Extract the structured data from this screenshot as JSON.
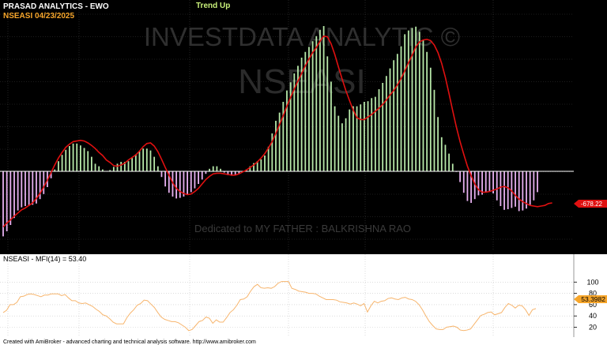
{
  "header": {
    "title": "PRASAD ANALYTICS - EWO",
    "symbol_date": "NSEASI  04/23/2025",
    "trend": "Trend Up"
  },
  "watermarks": {
    "brand": "INVESTDATA ANALYTIC ©",
    "symbol": "NSEASI",
    "dedication": "Dedicated to MY FATHER : BALKRISHNA RAO"
  },
  "footer": "Created with AmiBroker - advanced charting and technical analysis software. http://www.amibroker.com",
  "colors": {
    "top_bg": "#000000",
    "bar_up": "#b7e8a9",
    "bar_down": "#e7b0f0",
    "signal_line": "#e01010",
    "title_white": "#ffffff",
    "title_orange": "#f7a62b",
    "trend_green": "#c9f07a",
    "mfi_line": "#f7b56d",
    "value_label_bg": "#e01010",
    "mfi_label_bg": "#f7a62b"
  },
  "chart_data": [
    {
      "type": "bar",
      "series": [
        {
          "name": "EWO",
          "values": [
            -103,
            -95,
            -85,
            -74,
            -62,
            -57,
            -55,
            -55,
            -53,
            -51,
            -44,
            -36,
            -25,
            -11,
            3,
            16,
            26,
            34,
            40,
            44,
            44,
            41,
            37,
            32,
            23,
            12,
            8,
            3,
            0,
            2,
            7,
            12,
            15,
            15,
            16,
            21,
            27,
            32,
            36,
            36,
            33,
            23,
            8,
            -9,
            -24,
            -34,
            -40,
            -43,
            -42,
            -40,
            -37,
            -33,
            -27,
            -20,
            -13,
            -4,
            4,
            8,
            8,
            4,
            -2,
            -6,
            -7,
            -6,
            -4,
            -1,
            3,
            8,
            13,
            16,
            19,
            25,
            39,
            60,
            80,
            93,
            110,
            128,
            141,
            155,
            167,
            180,
            189,
            197,
            206,
            214,
            224,
            230,
            182,
            142,
            103,
            88,
            76,
            84,
            98,
            103,
            103,
            106,
            110,
            111,
            116,
            118,
            130,
            140,
            151,
            163,
            176,
            186,
            198,
            217,
            223,
            227,
            229,
            221,
            208,
            189,
            164,
            129,
            86,
            54,
            42,
            28,
            12,
            -1,
            -17,
            -34,
            -47,
            -50,
            -44,
            -38,
            -37,
            -33,
            -32,
            -35,
            -46,
            -55,
            -61,
            -60,
            -58,
            -56,
            -63,
            -62,
            -59,
            -53,
            -46,
            -33
          ]
        },
        {
          "name": "Signal",
          "values": [
            -88,
            -82,
            -77,
            -71,
            -66,
            -61,
            -58,
            -54,
            -50,
            -43,
            -35,
            -25,
            -14,
            -2,
            10,
            21,
            30,
            38,
            43,
            47,
            48,
            49,
            48,
            45,
            41,
            36,
            30,
            25,
            18,
            14,
            9,
            8,
            10,
            13,
            18,
            22,
            26,
            32,
            39,
            44,
            45,
            40,
            31,
            19,
            6,
            -6,
            -18,
            -27,
            -32,
            -35,
            -37,
            -36,
            -32,
            -27,
            -20,
            -13,
            -8,
            -4,
            -3,
            -3,
            -4,
            -5,
            -6,
            -6,
            -4,
            -1,
            2,
            6,
            10,
            15,
            21,
            28,
            37,
            47,
            60,
            74,
            88,
            103,
            117,
            130,
            143,
            155,
            167,
            178,
            188,
            196,
            206,
            214,
            213,
            202,
            185,
            165,
            146,
            128,
            112,
            97,
            85,
            82,
            82,
            86,
            90,
            95,
            100,
            106,
            113,
            121,
            128,
            137,
            147,
            159,
            172,
            184,
            197,
            205,
            208,
            209,
            207,
            200,
            188,
            171,
            149,
            123,
            96,
            70,
            47,
            27,
            8,
            -7,
            -20,
            -29,
            -33,
            -33,
            -32,
            -30,
            -28,
            -25,
            -24,
            -26,
            -31,
            -38,
            -44,
            -48,
            -51,
            -54,
            -55,
            -56,
            -55,
            -54,
            -51,
            -50
          ]
        }
      ],
      "current_value_label": "-678.22",
      "ylim": [
        -110,
        245
      ],
      "grid": true
    },
    {
      "type": "line",
      "title": "NSEASI - MFI(14) = 53.40",
      "series": [
        {
          "name": "MFI(14)",
          "values": [
            46,
            50,
            60,
            60,
            64,
            74,
            75,
            78,
            79,
            78,
            76,
            74,
            77,
            77,
            79,
            79,
            79,
            76,
            78,
            72,
            67,
            67,
            63,
            62,
            63,
            60,
            57,
            52,
            48,
            42,
            40,
            35,
            29,
            26,
            26,
            26,
            37,
            45,
            51,
            59,
            62,
            68,
            67,
            61,
            55,
            46,
            38,
            34,
            32,
            30,
            30,
            28,
            24,
            20,
            14,
            16,
            23,
            30,
            32,
            38,
            36,
            27,
            33,
            29,
            29,
            37,
            46,
            51,
            59,
            69,
            70,
            74,
            84,
            92,
            96,
            90,
            89,
            90,
            89,
            92,
            98,
            101,
            101,
            101,
            89,
            87,
            84,
            83,
            82,
            80,
            80,
            79,
            75,
            72,
            69,
            69,
            69,
            68,
            65,
            64,
            63,
            61,
            63,
            61,
            58,
            62,
            47,
            58,
            66,
            63,
            66,
            67,
            71,
            72,
            70,
            69,
            72,
            73,
            70,
            69,
            66,
            60,
            51,
            40,
            30,
            23,
            17,
            16,
            16,
            20,
            21,
            22,
            20,
            15,
            14,
            15,
            17,
            25,
            33,
            41,
            43,
            46,
            47,
            42,
            44,
            46,
            55,
            62,
            59,
            54,
            59,
            58,
            51,
            41,
            51,
            53
          ]
        }
      ],
      "current_value_label": "53.3982",
      "y_ticks": [
        100,
        80,
        60,
        40,
        20
      ],
      "ylim": [
        8,
        106
      ]
    }
  ]
}
